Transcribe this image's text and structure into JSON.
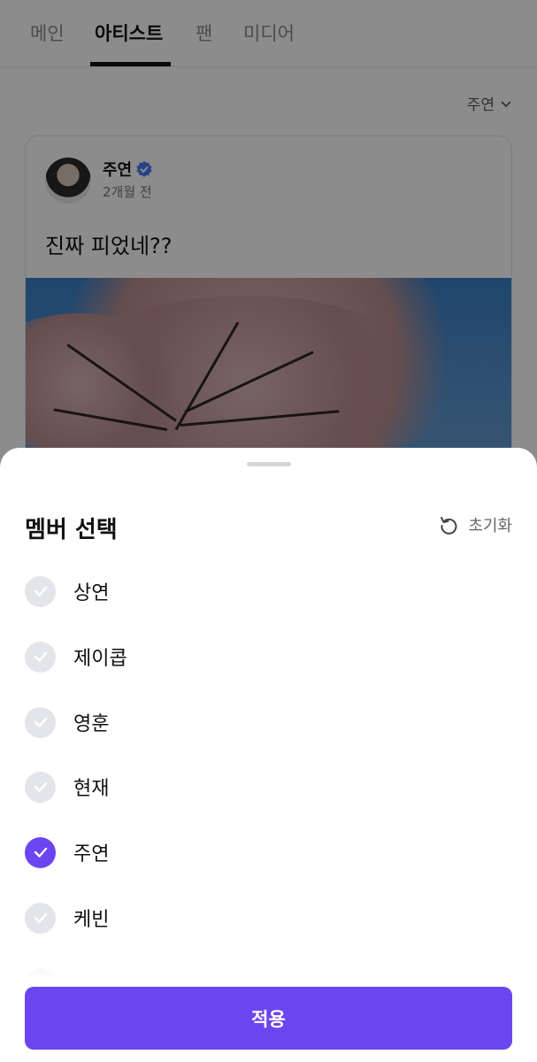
{
  "tabs": [
    {
      "label": "메인",
      "active": false
    },
    {
      "label": "아티스트",
      "active": true
    },
    {
      "label": "팬",
      "active": false
    },
    {
      "label": "미디어",
      "active": false
    }
  ],
  "filter": {
    "label": "주연",
    "icon": "chevron-down-icon"
  },
  "post": {
    "author": "주연",
    "verified_icon": "verified-badge-icon",
    "time": "2개월 전",
    "text": "진짜 피었네??"
  },
  "sheet": {
    "title": "멤버 선택",
    "reset_label": "초기화",
    "reset_icon": "reset-icon",
    "members": [
      {
        "name": "상연",
        "selected": false
      },
      {
        "name": "제이콥",
        "selected": false
      },
      {
        "name": "영훈",
        "selected": false
      },
      {
        "name": "현재",
        "selected": false
      },
      {
        "name": "주연",
        "selected": true
      },
      {
        "name": "케빈",
        "selected": false
      }
    ],
    "apply_label": "적용"
  },
  "colors": {
    "accent": "#6b46f0",
    "unchecked": "#e3e5ea",
    "verified": "#4a7bf7"
  }
}
